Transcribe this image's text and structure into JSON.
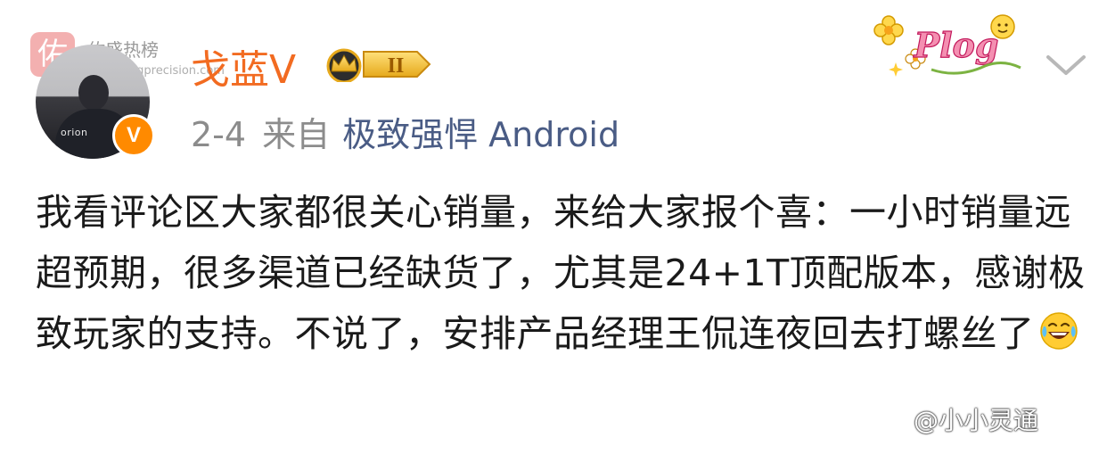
{
  "watermark": {
    "logo_char": "佑",
    "title": "佑盛热榜",
    "url": "youshengprecision.com"
  },
  "author": {
    "name": "戈蓝V",
    "avatar_text": "orion",
    "verified_mark": "V",
    "level_badge": "II"
  },
  "post": {
    "date": "2-4",
    "source_prefix": "来自",
    "source_device": "极致强悍 Android",
    "body": "我看评论区大家都很关心销量，来给大家报个喜：一小时销量远超预期，很多渠道已经缺货了，尤其是24+1T顶配版本，感谢极致玩家的支持。不说了，安排产品经理王侃连夜回去打螺丝了",
    "emoji": "laughing-tears"
  },
  "sticker": {
    "text": "Plog"
  },
  "footer": {
    "watermark": "@小小灵通"
  },
  "colors": {
    "username": "#f26b21",
    "source": "#4a5c85",
    "meta": "#8c8c8c",
    "verified": "#ff8a00"
  }
}
